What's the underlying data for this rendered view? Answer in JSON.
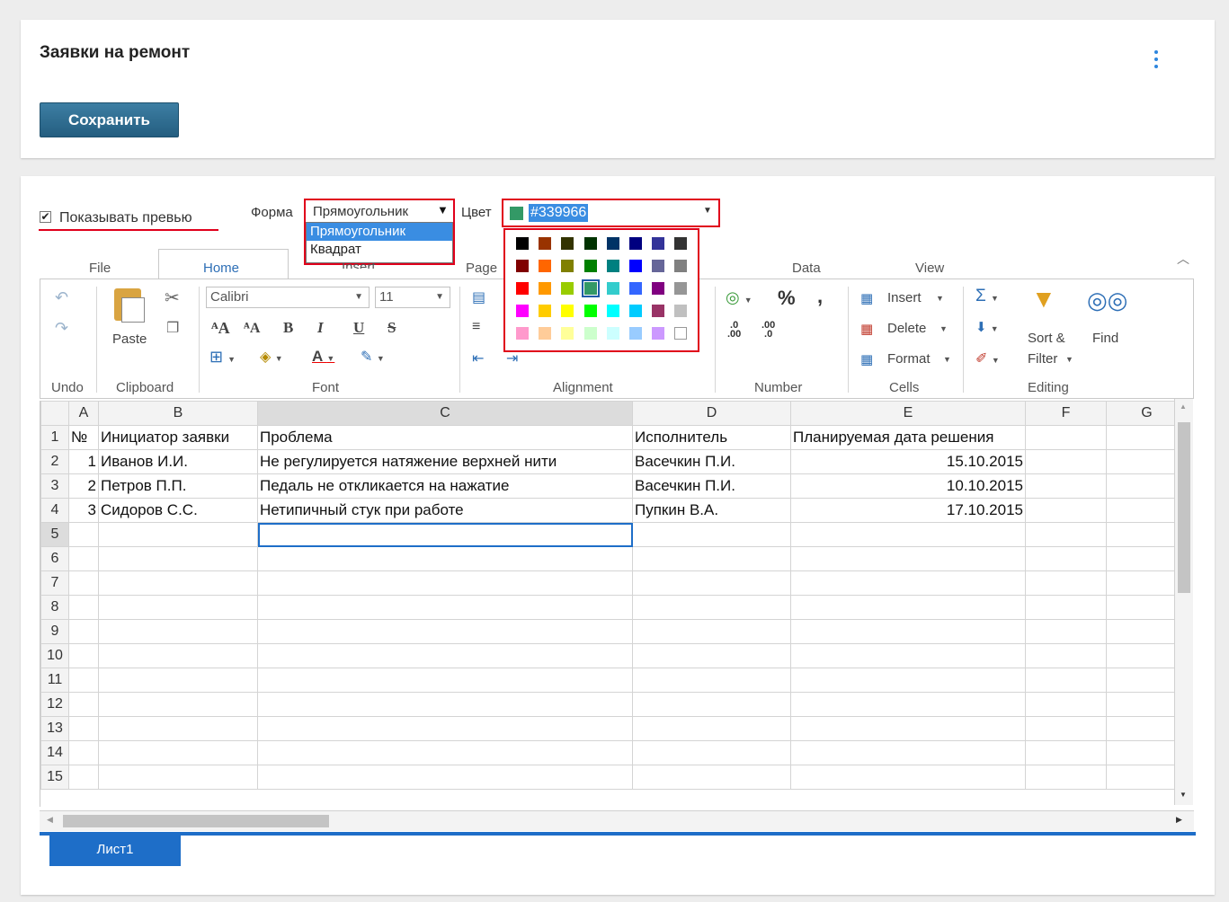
{
  "header": {
    "title": "Заявки на ремонт",
    "save_label": "Сохранить"
  },
  "options": {
    "show_preview_label": "Показывать превью",
    "shape_label": "Форма",
    "shape_value": "Прямоугольник",
    "shape_options": [
      "Прямоугольник",
      "Квадрат"
    ],
    "color_label": "Цвет",
    "color_value": "#339966"
  },
  "palette": [
    [
      "#000000",
      "#993300",
      "#333300",
      "#003300",
      "#003366",
      "#000080",
      "#333399",
      "#333333"
    ],
    [
      "#800000",
      "#ff6600",
      "#808000",
      "#008000",
      "#008080",
      "#0000ff",
      "#666699",
      "#808080"
    ],
    [
      "#ff0000",
      "#ff9900",
      "#99cc00",
      "#339966",
      "#33cccc",
      "#3366ff",
      "#800080",
      "#969696"
    ],
    [
      "#ff00ff",
      "#ffcc00",
      "#ffff00",
      "#00ff00",
      "#00ffff",
      "#00ccff",
      "#993366",
      "#c0c0c0"
    ],
    [
      "#ff99cc",
      "#ffcc99",
      "#ffff99",
      "#ccffcc",
      "#ccffff",
      "#99ccff",
      "#cc99ff",
      "#ffffff"
    ]
  ],
  "ribbon": {
    "tabs": [
      "File",
      "Home",
      "Insert",
      "Page",
      "Data",
      "View"
    ],
    "groups": {
      "undo": "Undo",
      "clipboard": "Clipboard",
      "font": "Font",
      "alignment": "Alignment",
      "number": "Number",
      "cells": "Cells",
      "editing": "Editing"
    },
    "paste": "Paste",
    "font_name": "Calibri",
    "font_size": "11",
    "cells_insert": "Insert",
    "cells_delete": "Delete",
    "cells_format": "Format",
    "sort_filter_1": "Sort &",
    "sort_filter_2": "Filter",
    "find": "Find"
  },
  "sheet": {
    "columns": [
      "A",
      "B",
      "C",
      "D",
      "E",
      "F",
      "G"
    ],
    "rows": [
      [
        "№",
        "Инициатор заявки",
        "Проблема",
        "Исполнитель",
        "Планируемая дата решения",
        "",
        ""
      ],
      [
        "1",
        "Иванов И.И.",
        "Не регулируется натяжение верхней нити",
        "Васечкин П.И.",
        "15.10.2015",
        "",
        ""
      ],
      [
        "2",
        "Петров П.П.",
        "Педаль не откликается на нажатие",
        "Васечкин П.И.",
        "10.10.2015",
        "",
        ""
      ],
      [
        "3",
        "Сидоров С.С.",
        "Нетипичный стук при работе",
        "Пупкин В.А.",
        "17.10.2015",
        "",
        ""
      ]
    ],
    "row_numbers": [
      "1",
      "2",
      "3",
      "4",
      "5",
      "6",
      "7",
      "8",
      "9",
      "10",
      "11",
      "12",
      "13",
      "14",
      "15"
    ],
    "sheet_tab": "Лист1"
  }
}
